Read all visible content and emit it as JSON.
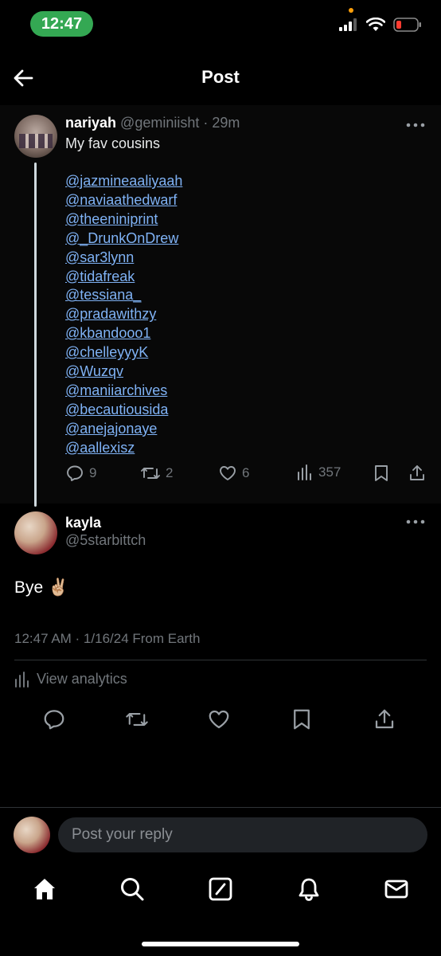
{
  "status_bar": {
    "time": "12:47"
  },
  "header": {
    "title": "Post"
  },
  "parent_post": {
    "author_name": "nariyah",
    "handle_time": "@geminiisht · 29m",
    "text": "My fav cousins",
    "mentions": [
      "@jazmineaaliyaah",
      "@naviaathedwarf",
      "@theeniniprint",
      "@_DrunkOnDrew",
      "@sar3lynn",
      "@tidafreak",
      "@tessiana_",
      "@pradawithzy",
      "@kbandooo1",
      "@chelleyyyK",
      "@Wuzqv",
      "@maniiarchives",
      "@becautiousida",
      "@anejajonaye",
      "@aallexisz"
    ],
    "replies_count": "9",
    "reposts_count": "2",
    "likes_count": "6",
    "views_count": "357"
  },
  "reply_post": {
    "author_name": "kayla",
    "handle": "@5starbittch",
    "text": "Bye ✌🏼",
    "meta": "12:47 AM · 1/16/24 From Earth",
    "analytics_label": "View analytics"
  },
  "composer": {
    "placeholder": "Post your reply"
  },
  "icons": {
    "back": "arrow-left-icon",
    "more": "more-horizontal-icon",
    "reply": "speech-bubble-icon",
    "repost": "repost-icon",
    "like": "heart-icon",
    "views": "bar-chart-icon",
    "bookmark": "bookmark-icon",
    "share": "share-icon",
    "home": "home-icon",
    "search": "search-icon",
    "grok": "grok-icon",
    "notifications": "bell-icon",
    "messages": "mail-icon"
  },
  "colors": {
    "link": "#7fb2f5",
    "muted": "#71767b",
    "status_pill": "#34a853",
    "battery_low": "#ff3b30"
  }
}
